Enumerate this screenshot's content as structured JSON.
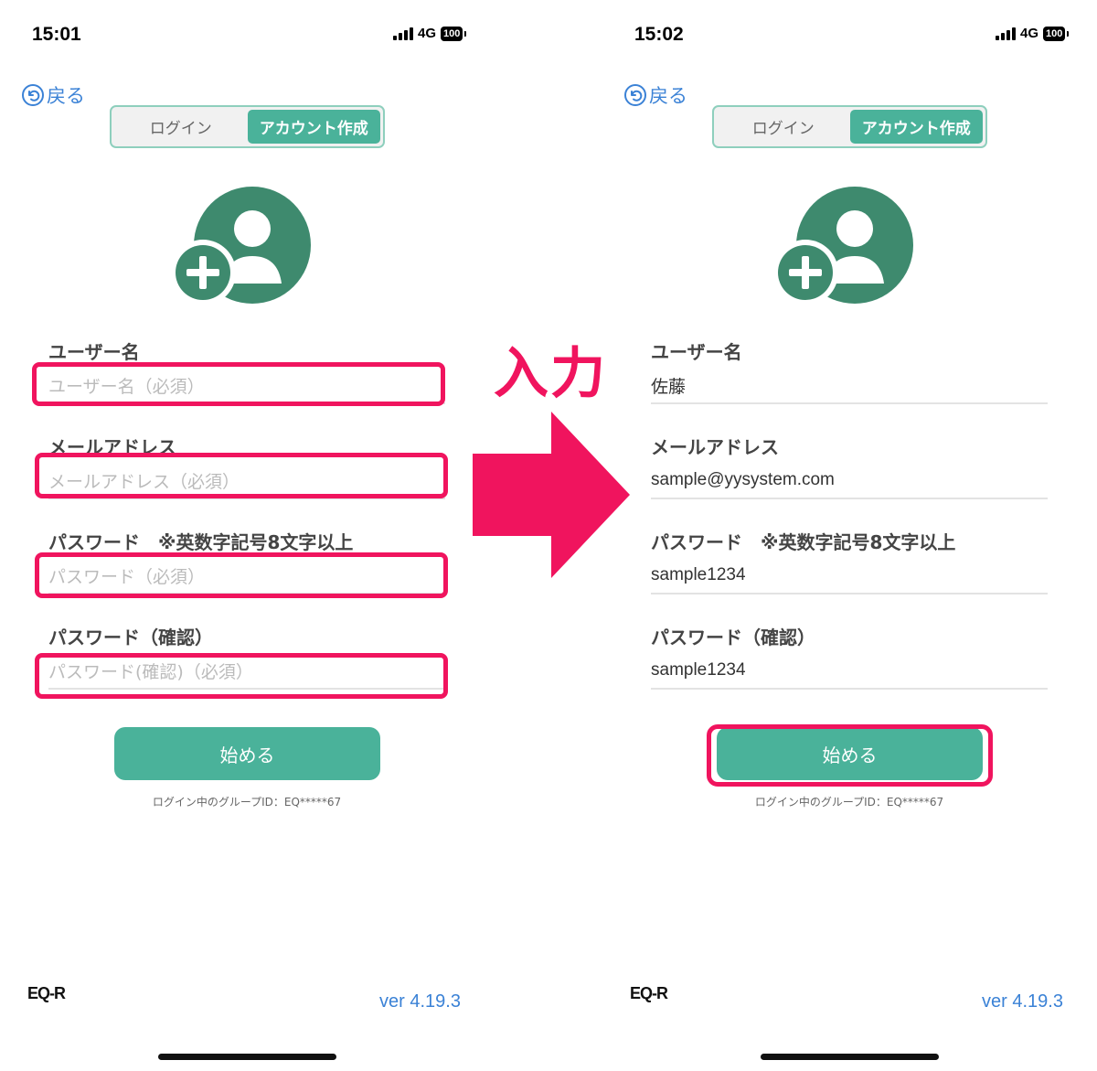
{
  "colors": {
    "accent": "#4ab29a",
    "avatar": "#3e8a6e",
    "link": "#3b82d6",
    "highlight": "#f0145e"
  },
  "annotation": {
    "text": "入力"
  },
  "screens": [
    {
      "status": {
        "time": "15:01",
        "network": "4G",
        "battery": "100"
      },
      "back": {
        "label": "戻る"
      },
      "tabs": {
        "login": "ログイン",
        "create": "アカウント作成",
        "selected": "アカウント作成"
      },
      "fields": [
        {
          "label": "ユーザー名",
          "value": "",
          "placeholder": "ユーザー名（必須）"
        },
        {
          "label": "メールアドレス",
          "value": "",
          "placeholder": "メールアドレス（必須）"
        },
        {
          "label": "パスワード　※英数字記号8文字以上",
          "value": "",
          "placeholder": "パスワード（必須）"
        },
        {
          "label": "パスワード（確認）",
          "value": "",
          "placeholder": "パスワード(確認)（必須）"
        }
      ],
      "start_button": "始める",
      "group_id": "ログイン中のグループID：EQ*****67",
      "logo": "EQ-R",
      "version": "ver 4.19.3"
    },
    {
      "status": {
        "time": "15:02",
        "network": "4G",
        "battery": "100"
      },
      "back": {
        "label": "戻る"
      },
      "tabs": {
        "login": "ログイン",
        "create": "アカウント作成",
        "selected": "アカウント作成"
      },
      "fields": [
        {
          "label": "ユーザー名",
          "value": "佐藤",
          "placeholder": ""
        },
        {
          "label": "メールアドレス",
          "value": "sample@yysystem.com",
          "placeholder": ""
        },
        {
          "label": "パスワード　※英数字記号8文字以上",
          "value": "sample1234",
          "placeholder": ""
        },
        {
          "label": "パスワード（確認）",
          "value": "sample1234",
          "placeholder": ""
        }
      ],
      "start_button": "始める",
      "group_id": "ログイン中のグループID：EQ*****67",
      "logo": "EQ-R",
      "version": "ver 4.19.3"
    }
  ]
}
